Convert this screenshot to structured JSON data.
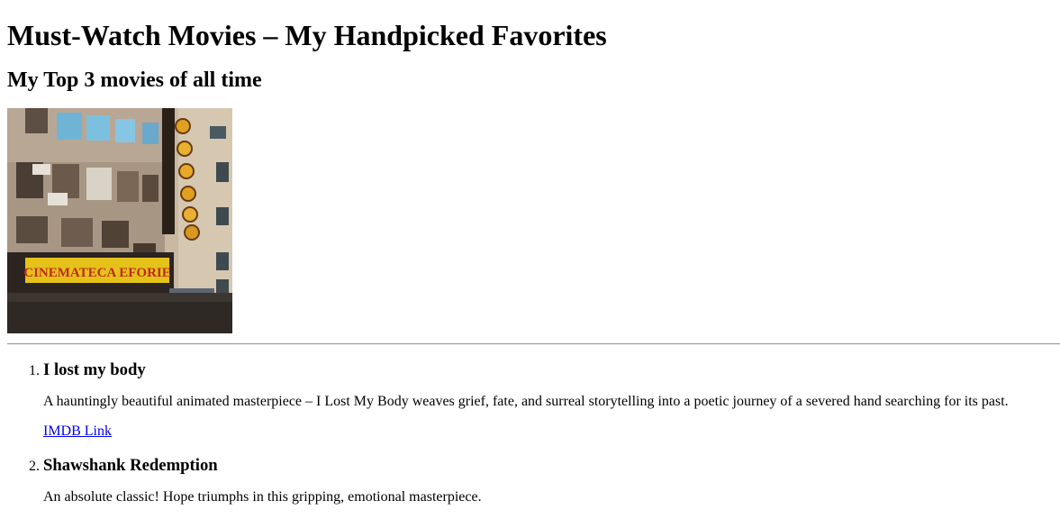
{
  "page": {
    "title": "Must-Watch Movies – My Handpicked Favorites",
    "subtitle": "My Top 3 movies of all time"
  },
  "hero_image": {
    "sign_text": "CINEMATECA EFORIE"
  },
  "movies": [
    {
      "number": "1.",
      "title": "I lost my body",
      "description": "A hauntingly beautiful animated masterpiece – I Lost My Body weaves grief, fate, and surreal storytelling into a poetic journey of a severed hand searching for its past.",
      "link_label": "IMDB Link"
    },
    {
      "number": "2.",
      "title": "Shawshank Redemption",
      "description": "An absolute classic! Hope triumphs in this gripping, emotional masterpiece."
    }
  ],
  "colors": {
    "link": "#0000ee",
    "rule": "#9a9a9a"
  }
}
